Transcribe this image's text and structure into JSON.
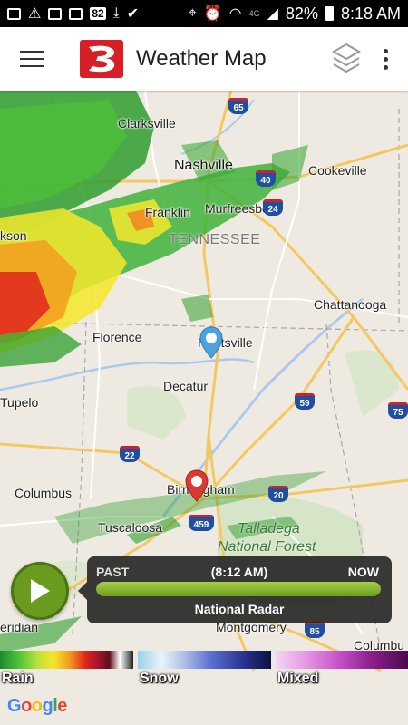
{
  "status_bar": {
    "battery": "82%",
    "time": "8:18 AM",
    "notif_count": "82",
    "network": "4G"
  },
  "app_bar": {
    "title": "Weather Map"
  },
  "map": {
    "state_label": "TENNESSEE",
    "forest_label_1": "Talladega",
    "forest_label_2": "National Forest",
    "cities": {
      "clarksville": "Clarksville",
      "nashville": "Nashville",
      "cookeville": "Cookeville",
      "franklin": "Franklin",
      "murfreesboro": "Murfreesboro",
      "jackson": "kson",
      "chattanooga": "Chattanooga",
      "florence": "Florence",
      "huntsville": "Huntsville",
      "decatur": "Decatur",
      "tupelo": "Tupelo",
      "columbus_ms": "Columbus",
      "birmingham": "Birmingham",
      "tuscaloosa": "Tuscaloosa",
      "meridian": "eridian",
      "montgomery": "Montgomery",
      "columbus_ga": "Columbu"
    },
    "shields": {
      "i65": "65",
      "i40": "40",
      "i24": "24",
      "i59": "59",
      "i75": "75",
      "i22": "22",
      "i20": "20",
      "i459": "459",
      "i85": "85"
    }
  },
  "timeline": {
    "past_label": "PAST",
    "time": "(8:12 AM)",
    "now_label": "NOW",
    "layer_name": "National Radar",
    "progress": 1.0
  },
  "legend": {
    "rain": "Rain",
    "snow": "Snow",
    "mixed": "Mixed"
  },
  "attribution": {
    "google": "Google"
  },
  "colors": {
    "brand_red": "#d61f26",
    "play_green": "#6b9b1e",
    "pin_blue": "#4aa3df",
    "pin_red": "#d83a34"
  }
}
